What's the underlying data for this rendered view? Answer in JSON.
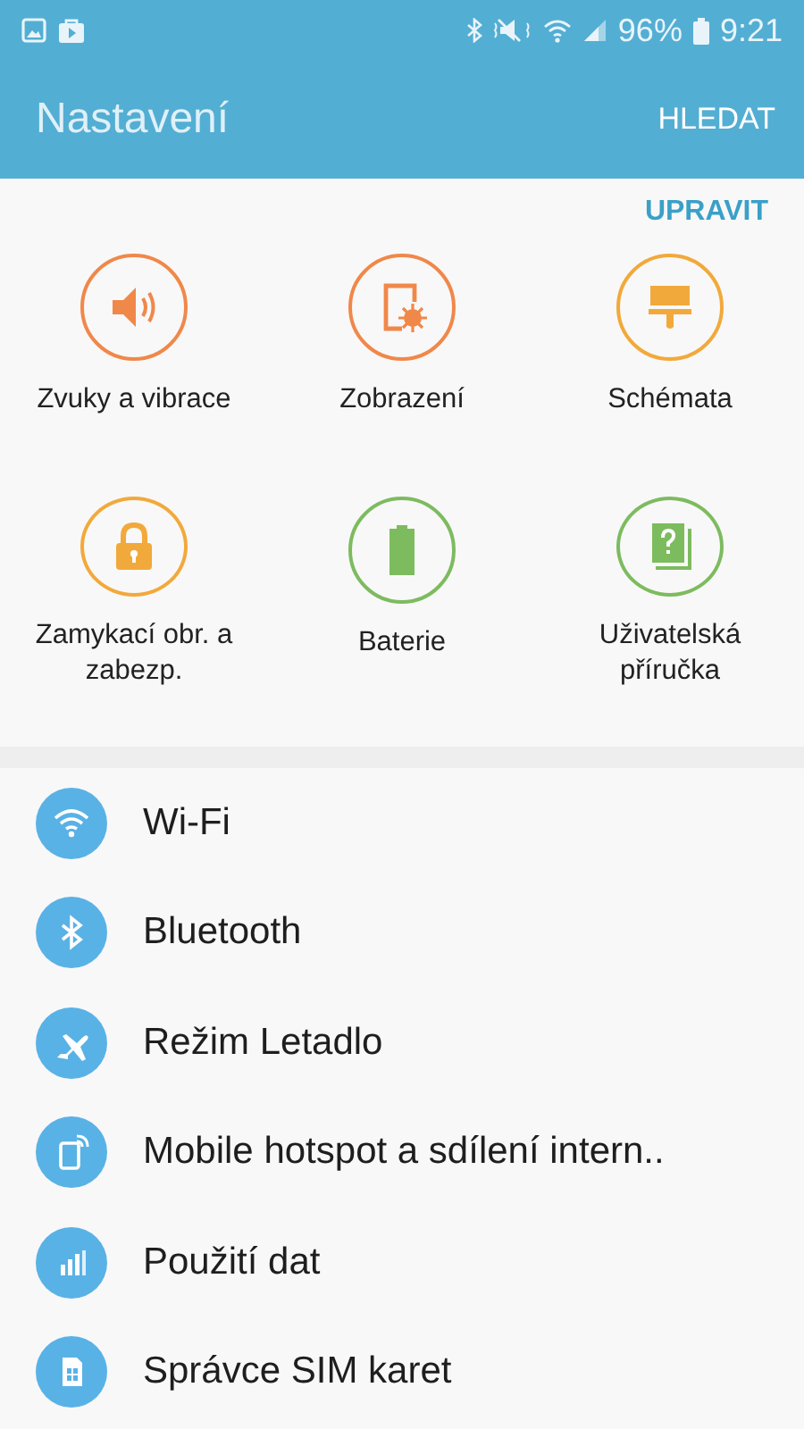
{
  "status_bar": {
    "battery_text": "96%",
    "time": "9:21"
  },
  "app_bar": {
    "title": "Nastavení",
    "action": "HLEDAT"
  },
  "quick_settings": {
    "edit": "UPRAVIT",
    "items": [
      {
        "label": "Zvuky a vibrace",
        "kind": "sound",
        "color": "#f0884a"
      },
      {
        "label": "Zobrazení",
        "kind": "display",
        "color": "#f0884a"
      },
      {
        "label": "Schémata",
        "kind": "themes",
        "color": "#f2a93b"
      },
      {
        "label": "Zamykací obr. a zabezp.",
        "kind": "lock",
        "color": "#f2a93b"
      },
      {
        "label": "Baterie",
        "kind": "battery",
        "color": "#7dbb5f"
      },
      {
        "label": "Uživatelská příručka",
        "kind": "manual",
        "color": "#7dbb5f"
      }
    ]
  },
  "settings": [
    {
      "label": "Wi-Fi",
      "kind": "wifi"
    },
    {
      "label": "Bluetooth",
      "kind": "bluetooth"
    },
    {
      "label": "Režim Letadlo",
      "kind": "airplane"
    },
    {
      "label": "Mobile hotspot a sdílení intern..",
      "kind": "hotspot"
    },
    {
      "label": "Použití dat",
      "kind": "data"
    },
    {
      "label": "Správce SIM karet",
      "kind": "sim"
    }
  ]
}
